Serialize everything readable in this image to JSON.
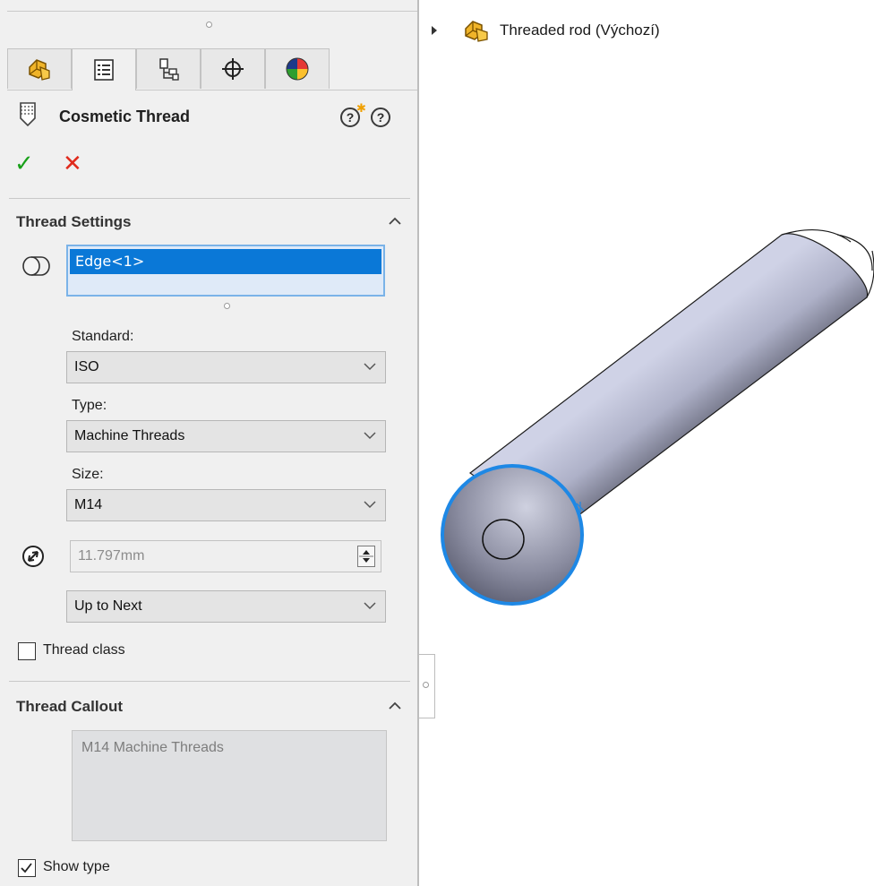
{
  "tree": {
    "part_name": "Threaded rod",
    "configuration": "(Výchozí)"
  },
  "property_manager": {
    "title": "Cosmetic Thread",
    "tabs": [
      {
        "name": "feature-manager",
        "icon": "part-icon"
      },
      {
        "name": "property-manager",
        "icon": "property-list-icon",
        "active": true
      },
      {
        "name": "configuration-manager",
        "icon": "configuration-icon"
      },
      {
        "name": "dimxpert-manager",
        "icon": "crosshair-icon"
      },
      {
        "name": "display-manager",
        "icon": "appearance-icon"
      }
    ],
    "help_whats_new": "?",
    "help": "?",
    "ok_label": "✓",
    "cancel_label": "✕"
  },
  "thread_settings": {
    "section_title": "Thread Settings",
    "edge_selection": "Edge<1>",
    "standard_label": "Standard:",
    "standard_value": "ISO",
    "type_label": "Type:",
    "type_value": "Machine Threads",
    "size_label": "Size:",
    "size_value": "M14",
    "minor_diameter": "11.797mm",
    "end_condition": "Up to Next",
    "thread_class_label": "Thread class",
    "thread_class_checked": false
  },
  "thread_callout": {
    "section_title": "Thread Callout",
    "callout_text": "M14 Machine Threads",
    "show_type_label": "Show type",
    "show_type_checked": true
  },
  "colors": {
    "selection_blue": "#0a78d7",
    "edge_highlight": "#1e88e5",
    "ok_green": "#18a019",
    "cancel_red": "#e02a1c",
    "panel_bg": "#f0f0f0"
  }
}
